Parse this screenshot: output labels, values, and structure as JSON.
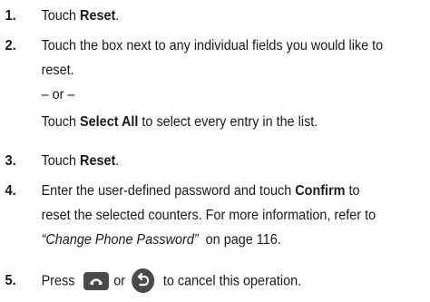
{
  "steps": [
    {
      "number": "1.",
      "parts": [
        "Touch ",
        "Reset",
        "."
      ]
    },
    {
      "number": "2.",
      "line1": "Touch the box next to any individual fields you would like to",
      "line2": "reset.",
      "or_text": "– or –",
      "line3_a": "Touch ",
      "line3_b": "Select All",
      "line3_c": " to select every entry in the list."
    },
    {
      "number": "3.",
      "parts": [
        "Touch ",
        "Reset",
        "."
      ]
    },
    {
      "number": "4.",
      "line1_a": "Enter the user-defined password and touch ",
      "line1_b": "Confirm",
      "line1_c": " to",
      "line2": "reset the selected counters. For more information, refer to",
      "line3_a": "“Change Phone Password”",
      "line3_b": "  on page 116."
    },
    {
      "number": "5.",
      "part_a": "Press",
      "part_b": "or",
      "part_c": "to cancel this operation.",
      "icons": [
        "end-key-icon",
        "back-key-icon"
      ]
    }
  ],
  "colors": {
    "text": "#1a1a1a",
    "key_background": "#4a4a4a",
    "key_glyph": "#ffffff"
  }
}
